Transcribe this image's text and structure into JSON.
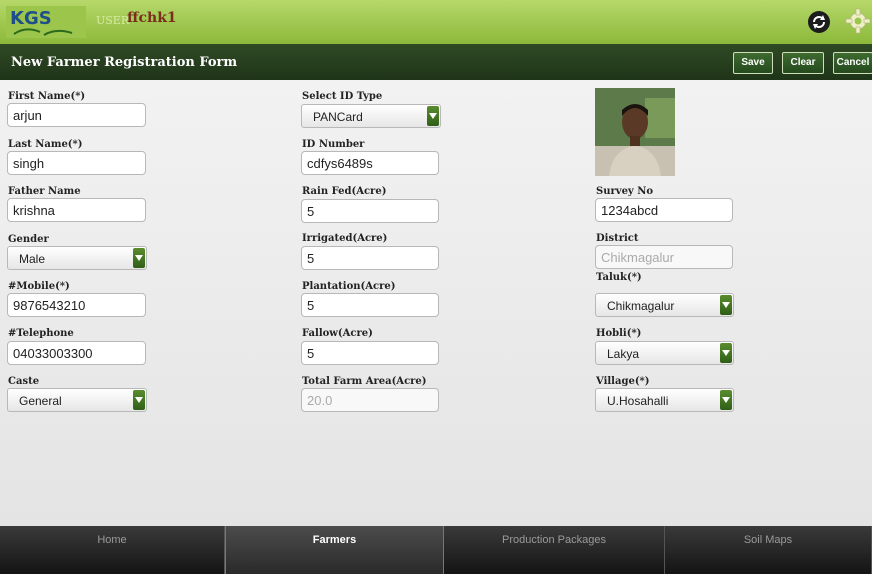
{
  "header": {
    "logo_text": "KGS",
    "user_label": "USER",
    "user_name": "ffchk1",
    "sync_icon": "sync-icon",
    "settings_icon": "gear-icon"
  },
  "titlebar": {
    "title": "New Farmer Registration Form",
    "save_label": "Save",
    "clear_label": "Clear",
    "cancel_label": "Cancel"
  },
  "form": {
    "first_name": {
      "label": "First Name(*)",
      "value": "arjun"
    },
    "last_name": {
      "label": "Last Name(*)",
      "value": "singh"
    },
    "father_name": {
      "label": "Father Name",
      "value": "krishna"
    },
    "gender": {
      "label": "Gender",
      "value": "Male"
    },
    "mobile": {
      "label": "#Mobile(*)",
      "value": "9876543210"
    },
    "telephone": {
      "label": "#Telephone",
      "value": "04033003300"
    },
    "caste": {
      "label": "Caste",
      "value": "General"
    },
    "id_type": {
      "label": "Select ID Type",
      "value": "PANCard"
    },
    "id_number": {
      "label": "ID Number",
      "value": "cdfys6489s"
    },
    "rain_fed": {
      "label": "Rain Fed(Acre)",
      "value": "5"
    },
    "irrigated": {
      "label": "Irrigated(Acre)",
      "value": "5"
    },
    "plantation": {
      "label": "Plantation(Acre)",
      "value": "5"
    },
    "fallow": {
      "label": "Fallow(Acre)",
      "value": "5"
    },
    "total_area": {
      "label": "Total Farm Area(Acre)",
      "value": "20.0"
    },
    "survey_no": {
      "label": "Survey No",
      "value": "1234abcd"
    },
    "district": {
      "label": "District",
      "value": "Chikmagalur"
    },
    "taluk": {
      "label": "Taluk(*)",
      "value": "Chikmagalur"
    },
    "hobli": {
      "label": "Hobli(*)",
      "value": "Lakya"
    },
    "village": {
      "label": "Village(*)",
      "value": "U.Hosahalli"
    }
  },
  "nav": {
    "tabs": [
      {
        "label": "Home"
      },
      {
        "label": "Farmers"
      },
      {
        "label": "Production Packages"
      },
      {
        "label": "Soil Maps"
      }
    ],
    "active": "Farmers"
  },
  "colors": {
    "header_green": "#8cb93a",
    "titlebar_green": "#1f3418",
    "accent_green": "#2f5f17"
  }
}
